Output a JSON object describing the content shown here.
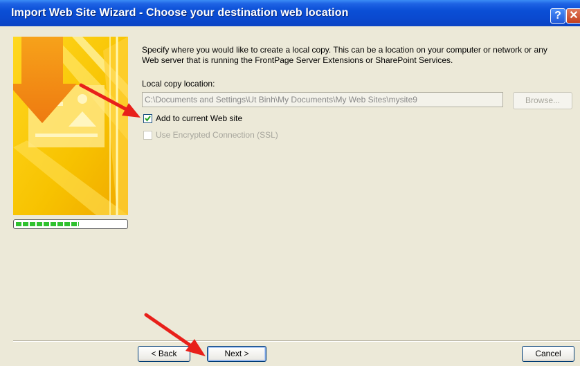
{
  "window": {
    "title": "Import Web Site Wizard - Choose your destination web location",
    "help_glyph": "?",
    "close_glyph": "✕"
  },
  "main": {
    "description": "Specify where you would like to create a local copy.  This can be a location on your computer or network or any Web server that is running the FrontPage Server Extensions or SharePoint Services.",
    "local_copy_label": "Local copy location:",
    "local_copy_value": "C:\\Documents and Settings\\Ut Binh\\My Documents\\My Web Sites\\mysite9",
    "browse_label": "Browse...",
    "add_to_current": {
      "label": "Add to current Web site",
      "checked": true
    },
    "use_ssl": {
      "label": "Use Encrypted Connection (SSL)",
      "checked": false,
      "enabled": false
    }
  },
  "buttons": {
    "back": "< Back",
    "next": "Next >",
    "cancel": "Cancel"
  },
  "progress": {
    "fraction": 0.57
  },
  "colors": {
    "title_bar": "#0a4fd6",
    "annotation_arrow": "#e8201a",
    "side_panel_yellow": "#f5c400"
  },
  "icons": [
    "help-icon",
    "close-icon",
    "wizard-illustration",
    "annotation-arrow"
  ]
}
